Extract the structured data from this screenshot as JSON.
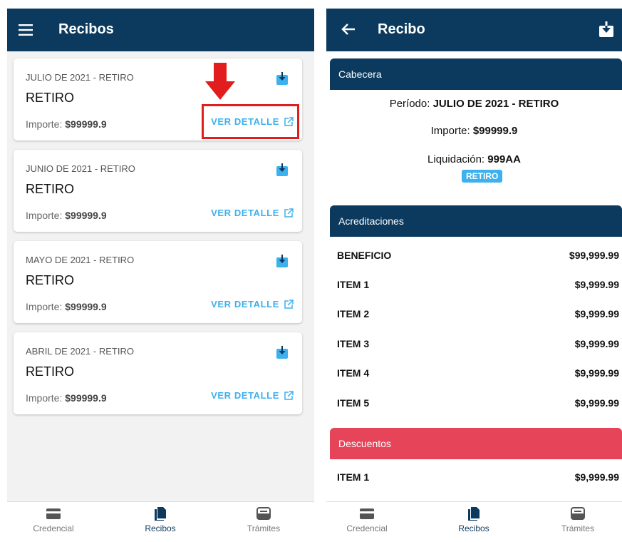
{
  "left": {
    "header": {
      "title": "Recibos"
    },
    "cards": [
      {
        "period": "JULIO DE 2021 - RETIRO",
        "title": "RETIRO",
        "amount_label": "Importe:",
        "amount": "$99999.9",
        "action": "VER DETALLE"
      },
      {
        "period": "JUNIO DE 2021 - RETIRO",
        "title": "RETIRO",
        "amount_label": "Importe:",
        "amount": "$99999.9",
        "action": "VER DETALLE"
      },
      {
        "period": "MAYO DE 2021 - RETIRO",
        "title": "RETIRO",
        "amount_label": "Importe:",
        "amount": "$99999.9",
        "action": "VER DETALLE"
      },
      {
        "period": "ABRIL DE 2021 - RETIRO",
        "title": "RETIRO",
        "amount_label": "Importe:",
        "amount": "$99999.9",
        "action": "VER DETALLE"
      }
    ]
  },
  "right": {
    "header": {
      "title": "Recibo"
    },
    "cabecera": {
      "title": "Cabecera",
      "periodo_label": "Período:",
      "periodo": "JULIO DE 2021 - RETIRO",
      "importe_label": "Importe:",
      "importe": "$99999.9",
      "liquidacion_label": "Liquidación:",
      "liquidacion": "999AA",
      "badge": "RETIRO"
    },
    "acreditaciones": {
      "title": "Acreditaciones",
      "rows": [
        {
          "label": "BENEFICIO",
          "value": "$99,999.99"
        },
        {
          "label": "ITEM 1",
          "value": "$9,999.99"
        },
        {
          "label": "ITEM 2",
          "value": "$9,999.99"
        },
        {
          "label": "ITEM 3",
          "value": "$9,999.99"
        },
        {
          "label": "ITEM 4",
          "value": "$9,999.99"
        },
        {
          "label": "ITEM 5",
          "value": "$9,999.99"
        }
      ]
    },
    "descuentos": {
      "title": "Descuentos",
      "rows": [
        {
          "label": "ITEM 1",
          "value": "$9,999.99"
        }
      ]
    }
  },
  "nav": {
    "items": [
      "Credencial",
      "Recibos",
      "Trámites"
    ]
  },
  "colors": {
    "primary": "#0b3a5e",
    "accent": "#3db0ee",
    "danger": "#e64459",
    "highlight": "#e11d1d"
  }
}
